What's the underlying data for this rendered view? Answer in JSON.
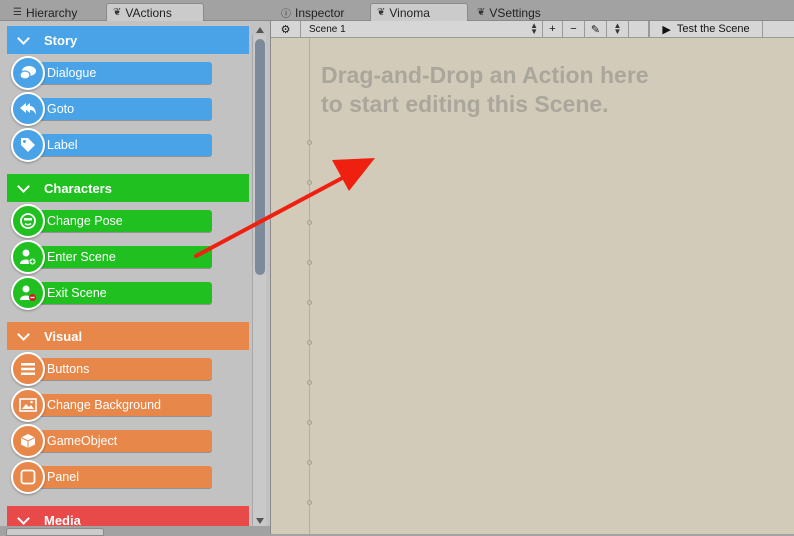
{
  "left_tabs": [
    {
      "icon": "list-icon",
      "label": "Hierarchy"
    },
    {
      "icon": "vinoma-logo-icon",
      "label": "VActions"
    }
  ],
  "right_tabs": [
    {
      "icon": "info-icon",
      "label": "Inspector"
    },
    {
      "icon": "vinoma-logo-icon",
      "label": "Vinoma"
    },
    {
      "icon": "vinoma-logo-icon",
      "label": "VSettings"
    }
  ],
  "colors": {
    "story": "#4aa3e6",
    "characters": "#20c020",
    "visual": "#e8874a",
    "media": "#e84a4a",
    "canvas": "#d2cbb9"
  },
  "categories": {
    "story": {
      "label": "Story",
      "items": [
        "Dialogue",
        "Goto",
        "Label"
      ]
    },
    "characters": {
      "label": "Characters",
      "items": [
        "Change Pose",
        "Enter Scene",
        "Exit Scene"
      ]
    },
    "visual": {
      "label": "Visual",
      "items": [
        "Buttons",
        "Change Background",
        "GameObject",
        "Panel"
      ]
    },
    "media": {
      "label": "Media"
    }
  },
  "toolbar": {
    "scene_select": "Scene 1",
    "add": "+",
    "remove": "−",
    "test_button": "Test the Scene"
  },
  "canvas": {
    "hint_line1": "Drag-and-Drop an Action here",
    "hint_line2": "to start editing this Scene."
  }
}
